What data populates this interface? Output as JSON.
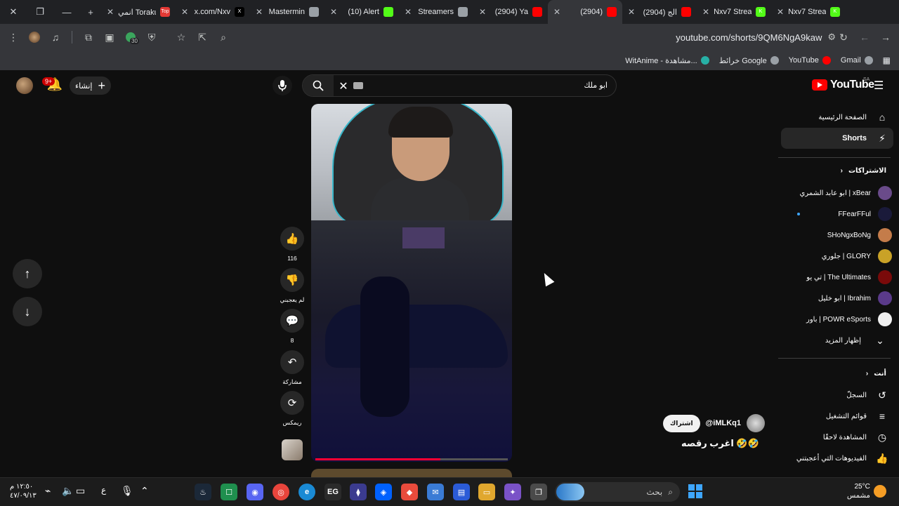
{
  "browser": {
    "tabs": [
      {
        "title": "انمي Toraku",
        "fav_color": "#e53935",
        "fav_text": "Top"
      },
      {
        "title": "x.com/Nxv",
        "fav_color": "#000000",
        "fav_text": "X"
      },
      {
        "title": "Mastermin",
        "fav_color": "#9aa0a6",
        "fav_text": ""
      },
      {
        "title": "(10) Alert",
        "fav_color": "#53fc18",
        "fav_text": ""
      },
      {
        "title": "Streamers",
        "fav_color": "#9aa0a6",
        "fav_text": ""
      },
      {
        "title": "(2904) Ya",
        "fav_color": "#ff0000",
        "fav_text": ""
      },
      {
        "title": "(2904)",
        "fav_color": "#ff0000",
        "fav_text": ""
      },
      {
        "title": "(2904) الج",
        "fav_color": "#ff0000",
        "fav_text": ""
      },
      {
        "title": "Nxv7 Strea",
        "fav_color": "#53fc18",
        "fav_text": "K"
      },
      {
        "title": "Nxv7 Strea",
        "fav_color": "#53fc18",
        "fav_text": "K"
      }
    ],
    "url": "youtube.com/shorts/9QM6NgA9kaw",
    "extension_badge": "30",
    "bookmarks": [
      {
        "label": "Gmail",
        "color": "#9aa0a6"
      },
      {
        "label": "YouTube",
        "color": "#ff0000"
      },
      {
        "label": "خرائط Google",
        "color": "#9aa0a6"
      },
      {
        "label": "WitAnime - مشاهدة...",
        "color": "#27b0a6"
      }
    ]
  },
  "youtube": {
    "logo_text": "YouTube",
    "logo_region": "SA",
    "search_query": "ابو ملك",
    "create_label": "إنشاء",
    "notification_count": "9+",
    "sidebar": {
      "main": [
        {
          "label": "الصفحة الرئيسية",
          "icon": "home-icon",
          "glyph": "⌂"
        },
        {
          "label": "Shorts",
          "icon": "shorts-icon",
          "glyph": "⚡"
        }
      ],
      "subscriptions_title": "الاشتراكات",
      "subscriptions": [
        {
          "label": "ابو عابد الشمري | xBear",
          "color": "#6a4b8a"
        },
        {
          "label": "FFearFFul",
          "color": "#1a1a3a"
        },
        {
          "label": "SHoNgxBoNg",
          "color": "#c47c4a"
        },
        {
          "label": "جلوري | GLORY",
          "color": "#c9a227"
        },
        {
          "label": "تي يو | The Ultimates",
          "color": "#7a0a0a"
        },
        {
          "label": "ابو خليل | Ibrahim",
          "color": "#5a3a8a"
        },
        {
          "label": "باور | POWR eSports",
          "color": "#f0f0f0"
        }
      ],
      "show_more": "إظهار المزيد",
      "you_title": "أنت",
      "you_items": [
        {
          "label": "السجلّ",
          "glyph": "↺"
        },
        {
          "label": "قوائم التشغيل",
          "glyph": "≡"
        },
        {
          "label": "المشاهدة لاحقًا",
          "glyph": "◷"
        },
        {
          "label": "الفيديوهات التي أعجبتني",
          "glyph": "👍"
        }
      ]
    },
    "short": {
      "likes": "116",
      "dislike_label": "لم يعجبني",
      "comments": "8",
      "share_label": "مشاركة",
      "remix_label": "ريمكس",
      "channel_handle": "@iMLKq1",
      "subscribe_label": "اشتراك",
      "title": "اغرب رقصه 🤣🤣",
      "progress": 0.65
    }
  },
  "taskbar": {
    "time": "١٢:٥٠ م",
    "date": "٤٧/٠٩/١٣",
    "lang": "ع",
    "search_placeholder": "بحث",
    "weather_temp": "25°C",
    "weather_desc": "مشمس"
  }
}
